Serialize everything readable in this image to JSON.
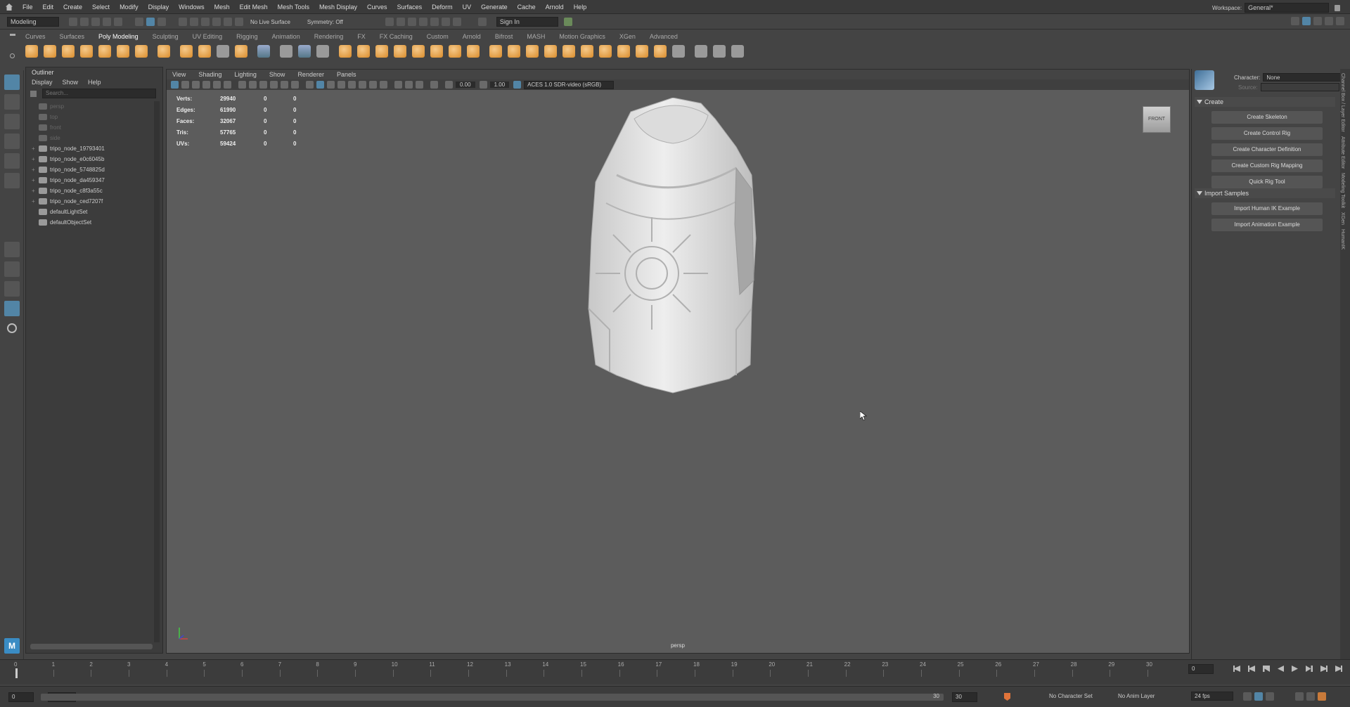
{
  "menus": [
    "File",
    "Edit",
    "Create",
    "Select",
    "Modify",
    "Display",
    "Windows",
    "Mesh",
    "Edit Mesh",
    "Mesh Tools",
    "Mesh Display",
    "Curves",
    "Surfaces",
    "Deform",
    "UV",
    "Generate",
    "Cache",
    "Arnold",
    "Help"
  ],
  "workspace": {
    "label": "Workspace:",
    "value": "General*"
  },
  "status": {
    "mode": "Modeling",
    "live_surface": "No Live Surface",
    "symmetry": "Symmetry: Off",
    "sign_in": "Sign In"
  },
  "shelf_tabs": [
    "Curves",
    "Surfaces",
    "Poly Modeling",
    "Sculpting",
    "UV Editing",
    "Rigging",
    "Animation",
    "Rendering",
    "FX",
    "FX Caching",
    "Custom",
    "Arnold",
    "Bifrost",
    "MASH",
    "Motion Graphics",
    "XGen",
    "Advanced"
  ],
  "outliner": {
    "title": "Outliner",
    "menu": [
      "Display",
      "Show",
      "Help"
    ],
    "search_placeholder": "Search...",
    "items": [
      {
        "label": "persp",
        "dim": true,
        "expand": ""
      },
      {
        "label": "top",
        "dim": true,
        "expand": ""
      },
      {
        "label": "front",
        "dim": true,
        "expand": ""
      },
      {
        "label": "side",
        "dim": true,
        "expand": ""
      },
      {
        "label": "tripo_node_19793401",
        "dim": false,
        "expand": "+"
      },
      {
        "label": "tripo_node_e0c6045b",
        "dim": false,
        "expand": "+"
      },
      {
        "label": "tripo_node_5748825d",
        "dim": false,
        "expand": "+"
      },
      {
        "label": "tripo_node_da459347",
        "dim": false,
        "expand": "+"
      },
      {
        "label": "tripo_node_c8f3a55c",
        "dim": false,
        "expand": "+"
      },
      {
        "label": "tripo_node_ced7207f",
        "dim": false,
        "expand": "+"
      },
      {
        "label": "defaultLightSet",
        "dim": false,
        "expand": ""
      },
      {
        "label": "defaultObjectSet",
        "dim": false,
        "expand": ""
      }
    ]
  },
  "viewport": {
    "menu": [
      "View",
      "Shading",
      "Lighting",
      "Show",
      "Renderer",
      "Panels"
    ],
    "exposure": "0.00",
    "gamma": "1.00",
    "color_space": "ACES 1.0 SDR-video (sRGB)",
    "camera_label": "persp",
    "view_cube": "FRONT",
    "hud": [
      {
        "label": "Verts:",
        "a": "29940",
        "b": "0",
        "c": "0"
      },
      {
        "label": "Edges:",
        "a": "61990",
        "b": "0",
        "c": "0"
      },
      {
        "label": "Faces:",
        "a": "32067",
        "b": "0",
        "c": "0"
      },
      {
        "label": "Tris:",
        "a": "57765",
        "b": "0",
        "c": "0"
      },
      {
        "label": "UVs:",
        "a": "59424",
        "b": "0",
        "c": "0"
      }
    ]
  },
  "humanik": {
    "character_label": "Character:",
    "character_value": "None",
    "source_label": "Source:",
    "create_section": "Create",
    "create_buttons": [
      "Create Skeleton",
      "Create Control Rig",
      "Create Character Definition",
      "Create Custom Rig Mapping",
      "Quick Rig Tool"
    ],
    "import_section": "Import Samples",
    "import_buttons": [
      "Import Human IK Example",
      "Import Animation Example"
    ]
  },
  "side_tabs": [
    "Channel Box / Layer Editor",
    "Attribute Editor",
    "Modeling Toolkit",
    "XGen",
    "HumanIK"
  ],
  "timeline": {
    "ticks": [
      "0",
      "1",
      "2",
      "3",
      "4",
      "5",
      "6",
      "7",
      "8",
      "9",
      "10",
      "11",
      "12",
      "13",
      "14",
      "15",
      "16",
      "17",
      "18",
      "19",
      "20",
      "21",
      "22",
      "23",
      "24",
      "25",
      "26",
      "27",
      "28",
      "29",
      "30"
    ],
    "current_frame": "0"
  },
  "range": {
    "start": "0",
    "inner_start": "0",
    "inner_end": "30",
    "end": "30",
    "character_set": "No Character Set",
    "anim_layer": "No Anim Layer",
    "fps": "24 fps"
  },
  "colors": {
    "accent": "#5285a6",
    "bg": "#444444",
    "viewport": "#5c5c5c"
  }
}
